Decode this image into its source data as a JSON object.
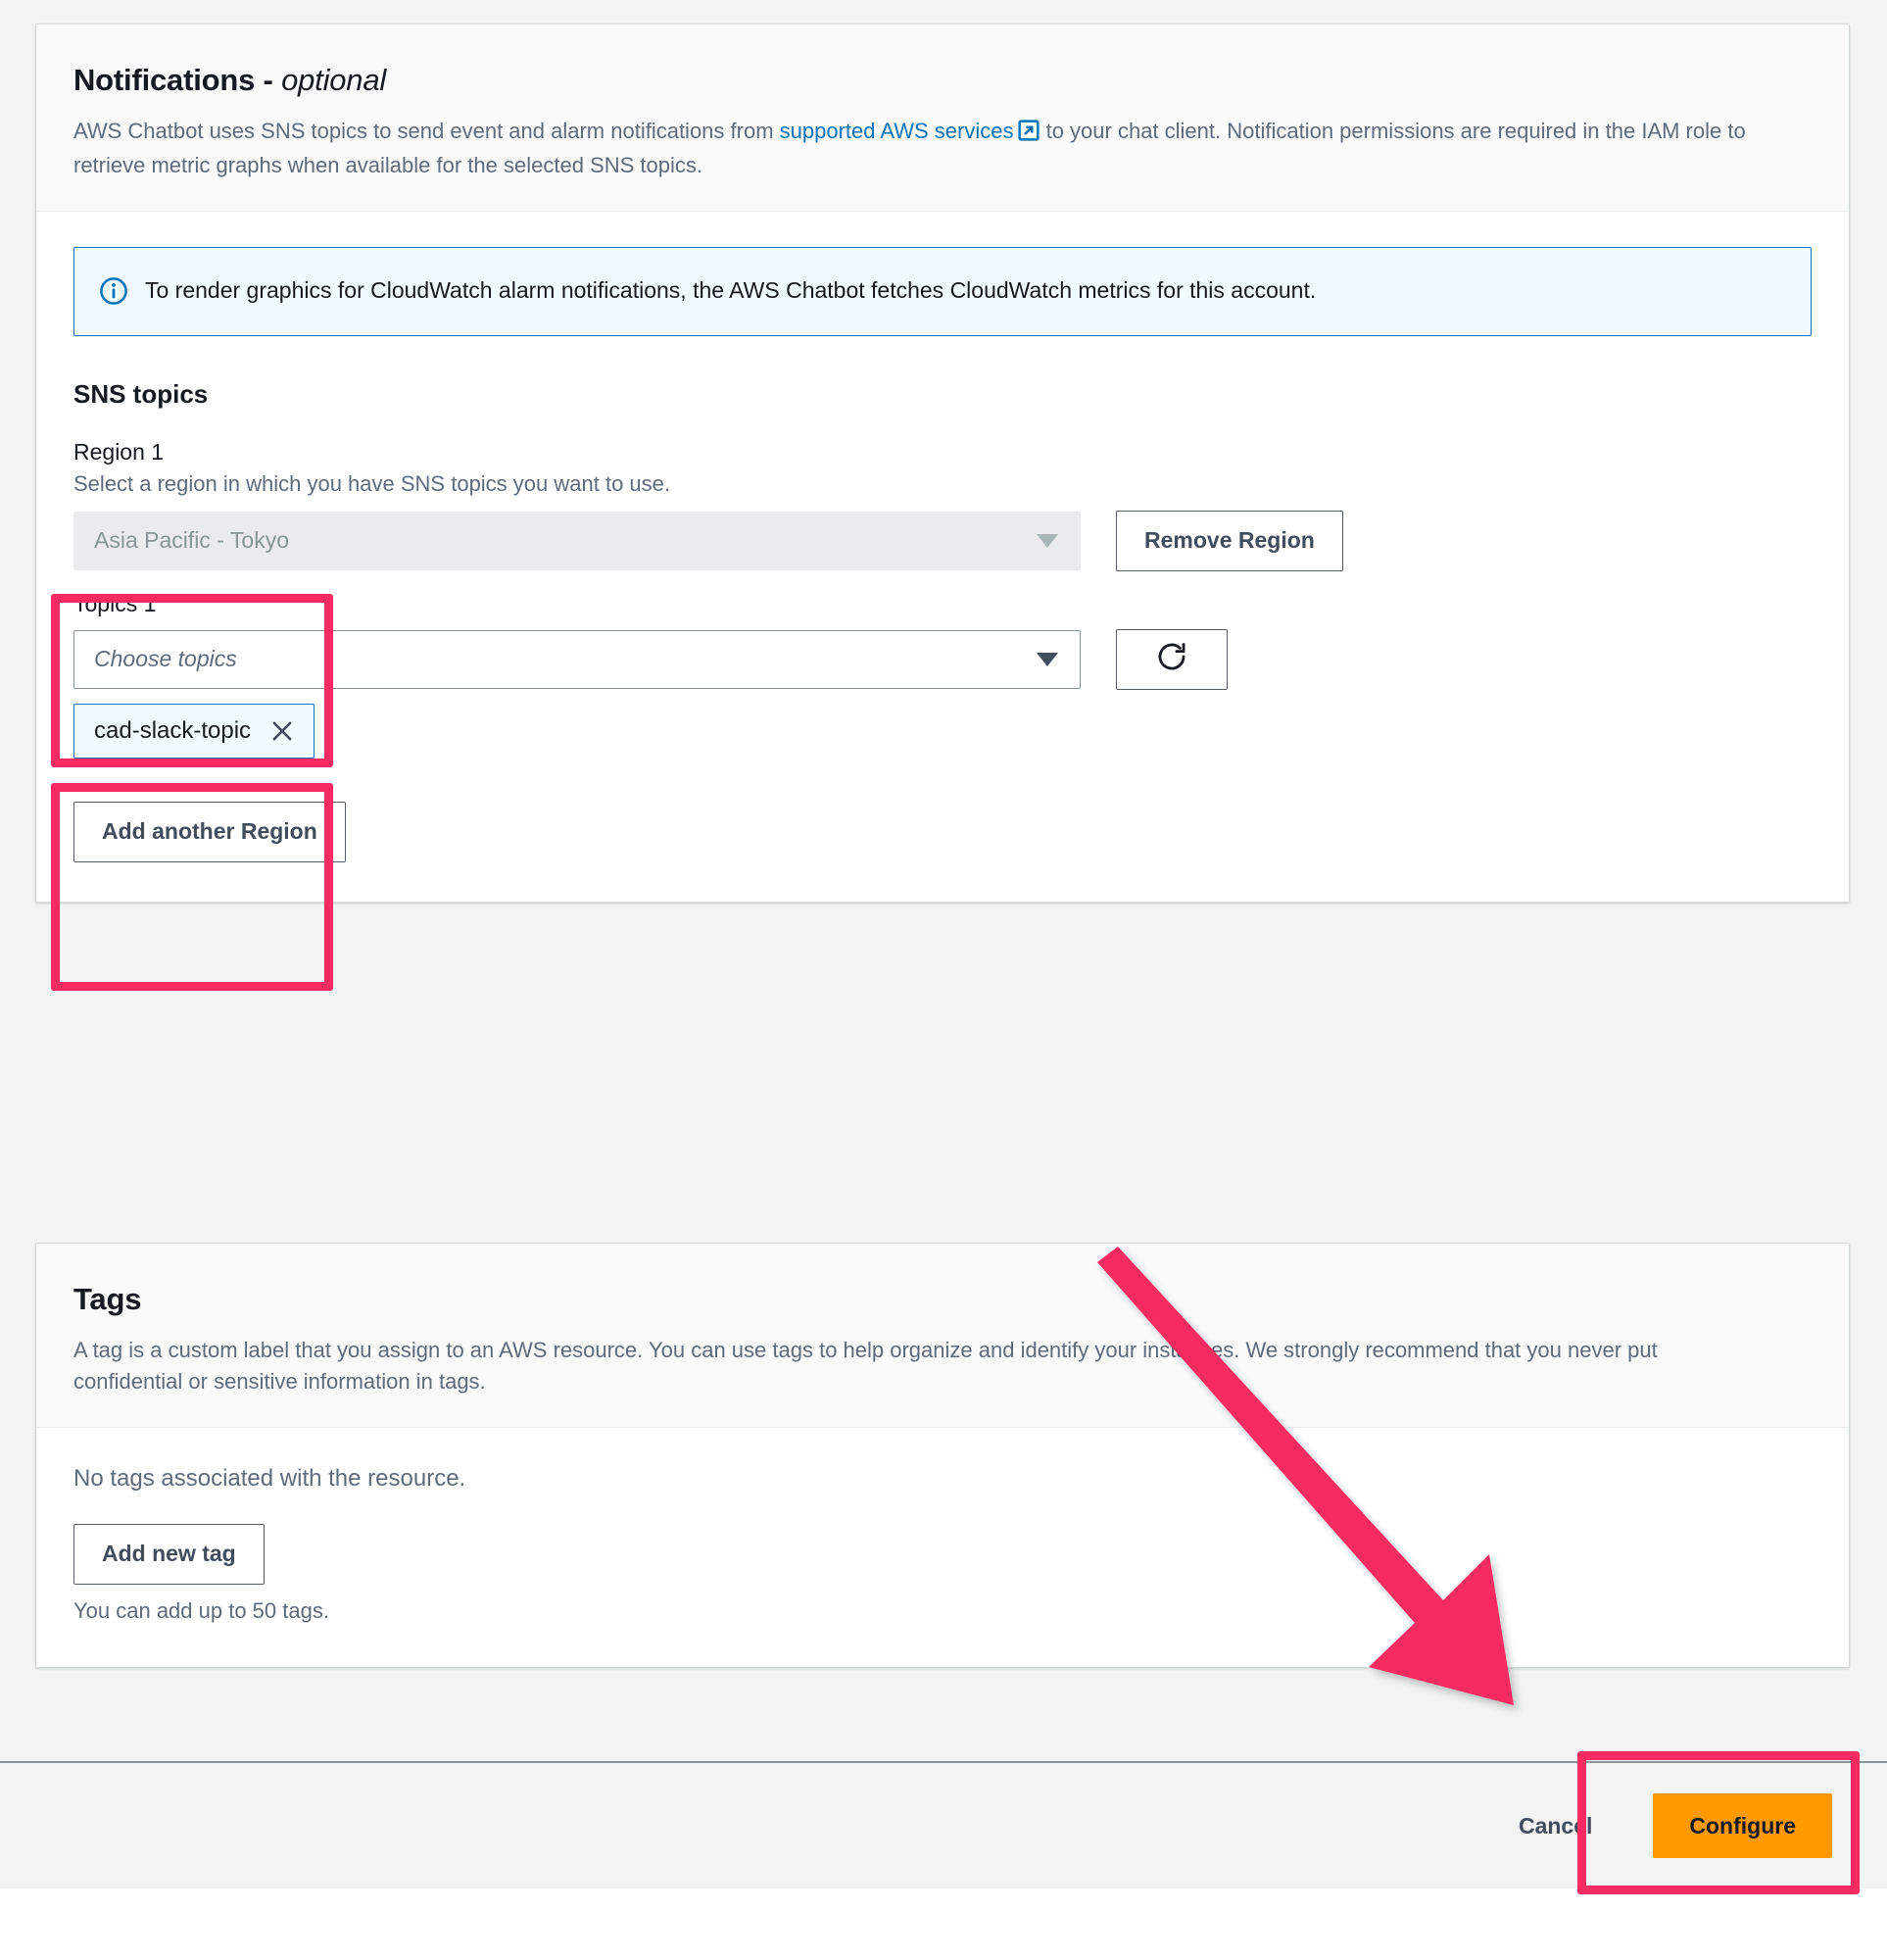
{
  "notifications": {
    "title": "Notifications - ",
    "title_optional": "optional",
    "desc_part1": "AWS Chatbot uses SNS topics to send event and alarm notifications from ",
    "desc_link": "supported AWS services",
    "desc_link_icon": "external-link-icon",
    "desc_part2": " to your chat client. Notification permissions are required in the IAM role to retrieve metric graphs when available for the selected SNS topics.",
    "alert": {
      "icon": "info-circle-icon",
      "text": "To render graphics for CloudWatch alarm notifications, the AWS Chatbot fetches CloudWatch metrics for this account."
    },
    "sns_topics_heading": "SNS topics",
    "region": {
      "label": "Region 1",
      "hint": "Select a region in which you have SNS topics you want to use.",
      "selected_value": "Asia Pacific - Tokyo",
      "disabled": true,
      "remove_button": "Remove Region"
    },
    "topics": {
      "label": "Topics 1",
      "placeholder": "Choose topics",
      "refresh_icon": "refresh-icon",
      "chips": [
        {
          "label": "cad-slack-topic",
          "close_icon": "close-icon"
        }
      ]
    },
    "add_region_button": "Add another Region"
  },
  "tags": {
    "title": "Tags",
    "desc": "A tag is a custom label that you assign to an AWS resource. You can use tags to help organize and identify your instances. We strongly recommend that you never put confidential or sensitive information in tags.",
    "empty_text": "No tags associated with the resource.",
    "add_button": "Add new tag",
    "limit_hint": "You can add up to 50 tags."
  },
  "footer": {
    "cancel_label": "Cancel",
    "configure_label": "Configure"
  },
  "annotations": {
    "highlight_color": "#f72a62",
    "arrow_color": "#f72a62",
    "targets": [
      "region-1-field",
      "topics-1-field",
      "configure-button"
    ]
  }
}
